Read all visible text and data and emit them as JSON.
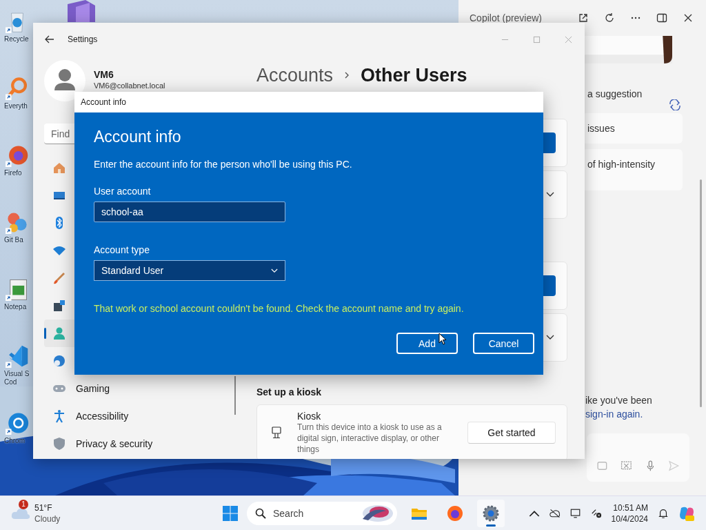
{
  "desktop": {
    "icons": [
      {
        "kind": "recycle",
        "lines": [
          "Recycle"
        ]
      },
      {
        "kind": "everything",
        "lines": [
          "Everyth"
        ]
      },
      {
        "kind": "firefox",
        "lines": [
          "Firefo"
        ]
      },
      {
        "kind": "git",
        "lines": [
          "Git Ba"
        ]
      },
      {
        "kind": "notepad",
        "lines": [
          "Notepa"
        ]
      },
      {
        "kind": "vscode",
        "lines": [
          "Visual S",
          "Cod"
        ]
      },
      {
        "kind": "chrome",
        "lines": [
          "Chrom"
        ]
      }
    ]
  },
  "copilot": {
    "title": "Copilot (preview)",
    "prompt": "a suggestion",
    "suggestions": [
      "issues",
      "of high-intensity"
    ],
    "message": "ike you've been",
    "link": "sign-in again."
  },
  "settings": {
    "title": "Settings",
    "user": {
      "name": "VM6",
      "email": "VM6@collabnet.local"
    },
    "search": {
      "placeholder": "Find"
    },
    "nav": [
      {
        "kind": "home",
        "selected": false
      },
      {
        "kind": "system",
        "selected": false
      },
      {
        "kind": "bluetooth",
        "selected": false
      },
      {
        "kind": "network",
        "selected": false
      },
      {
        "kind": "personalization",
        "selected": false
      },
      {
        "kind": "apps",
        "selected": false
      },
      {
        "kind": "accounts",
        "selected": true
      },
      {
        "kind": "time",
        "selected": false
      },
      {
        "kind": "gaming",
        "label": "Gaming",
        "selected": false
      },
      {
        "kind": "accessibility",
        "label": "Accessibility",
        "selected": false
      },
      {
        "kind": "privacy",
        "label": "Privacy & security",
        "selected": false
      }
    ],
    "breadcrumb": {
      "parent": "Accounts",
      "current": "Other Users"
    },
    "cards": [
      {
        "kind": "button"
      },
      {
        "kind": "expander"
      },
      {
        "kind": "button"
      },
      {
        "kind": "expander"
      }
    ],
    "kiosk": {
      "heading": "Set up a kiosk",
      "title": "Kiosk",
      "description": "Turn this device into a kiosk to use as a digital sign, interactive display, or other things",
      "button": "Get started"
    }
  },
  "dialog": {
    "title": "Account info",
    "heading": "Account info",
    "description": "Enter the account info for the person who'll be using this PC.",
    "user_account": {
      "label": "User account",
      "value": "school-aa"
    },
    "account_type": {
      "label": "Account type",
      "value": "Standard User"
    },
    "error": "That work or school account couldn't be found. Check the account name and try again.",
    "buttons": [
      "Add",
      "Cancel"
    ]
  },
  "taskbar": {
    "weather": {
      "badge": "1",
      "temperature": "51°F",
      "condition": "Cloudy"
    },
    "search": {
      "placeholder": "Search"
    },
    "apps": [
      {
        "kind": "explorer",
        "active": false
      },
      {
        "kind": "firefox",
        "active": false
      },
      {
        "kind": "settings",
        "active": true
      }
    ],
    "time": "10:51 AM",
    "date": "10/4/2024"
  }
}
